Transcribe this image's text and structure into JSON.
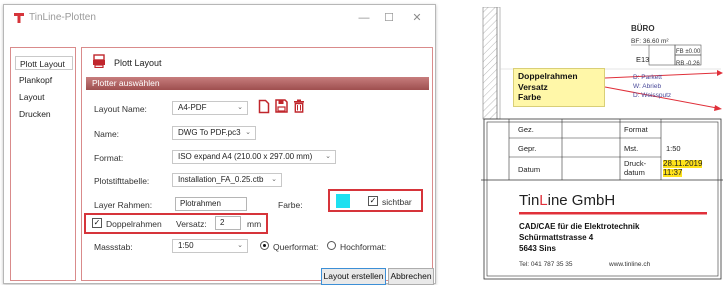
{
  "window": {
    "title": "TinLine-Plotten",
    "controls": {
      "minimize": "—",
      "maximize": "☐",
      "close": "✕"
    }
  },
  "sidebar": {
    "items": [
      {
        "label": "Plott Layout",
        "active": true
      },
      {
        "label": "Plankopf",
        "active": false
      },
      {
        "label": "Layout",
        "active": false
      },
      {
        "label": "Drucken",
        "active": false
      }
    ]
  },
  "panel": {
    "title": "Plott Layout",
    "section": "Plotter auswählen"
  },
  "form": {
    "layout_name_label": "Layout Name:",
    "layout_name_value": "A4-PDF",
    "name_label": "Name:",
    "name_value": "DWG To PDF.pc3",
    "format_label": "Format:",
    "format_value": "ISO expand A4 (210.00 x 297.00 mm)",
    "plotstyle_label": "Plotstifttabelle:",
    "plotstyle_value": "Installation_FA_0.25.ctb",
    "layer_label": "Layer Rahmen:",
    "layer_value": "Plotrahmen",
    "color_label": "Farbe:",
    "color_value": "#1ee0f0",
    "visible_label": "sichtbar",
    "visible_checked": true,
    "double_frame_label": "Doppelrahmen",
    "double_frame_checked": true,
    "offset_label": "Versatz:",
    "offset_value": "2",
    "offset_unit": "mm",
    "scale_label": "Massstab:",
    "scale_value": "1:50",
    "landscape_label": "Querformat:",
    "portrait_label": "Hochformat:",
    "orientation": "landscape"
  },
  "buttons": {
    "create_layout": "Layout erstellen",
    "cancel": "Abbrechen"
  },
  "icons": {
    "new": "new-document-icon",
    "save": "save-icon",
    "delete": "delete-icon"
  },
  "colors": {
    "accent_red": "#d6343a",
    "section_bar": "#b06262",
    "highlight": "#fff7a8",
    "date_highlight": "#ffe21a"
  },
  "drawing": {
    "room": {
      "name": "BÜRO",
      "area": "BF: 36.60 m²",
      "code": "E13",
      "fb": "FB ±0.00",
      "rb": "RB -0.26",
      "floor": "D: Parkett",
      "wall": "W: Abrieb",
      "ceiling": "D: Weissputz"
    },
    "callout": [
      "Doppelrahmen",
      "Versatz",
      "Farbe"
    ],
    "title_block": {
      "rows": [
        {
          "left": "Gez.",
          "right_label": "Format",
          "right_value": ""
        },
        {
          "left": "Gepr.",
          "right_label": "Mst.",
          "right_value": "1:50"
        },
        {
          "left": "Datum",
          "right_label": "Druck- datum",
          "right_value": "28.11.2019 11:37"
        }
      ],
      "druck_line1": "Druck-",
      "druck_line2": "datum",
      "date_line1": "28.11.2019",
      "date_line2": "11:37"
    },
    "company": {
      "name_pre": "Tin",
      "name_accent": "L",
      "name_post": "ine GmbH",
      "subtitle": "CAD/CAE für die Elektrotechnik",
      "street": "Schürmattstrasse 4",
      "city": "5643 Sins",
      "phone": "Tel:  041 787 35 35",
      "web": "www.tinline.ch"
    }
  }
}
